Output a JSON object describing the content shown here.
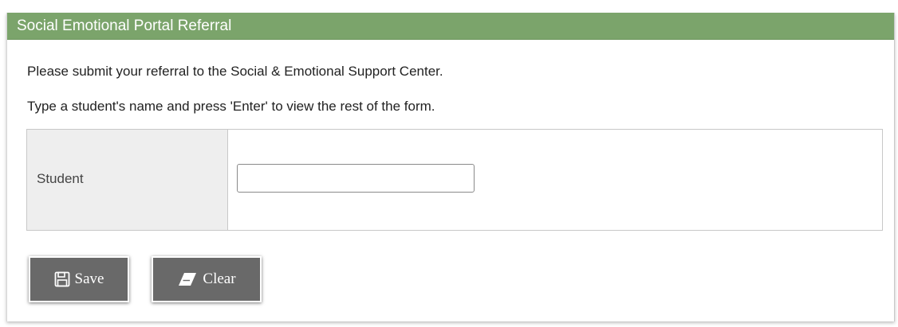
{
  "panel": {
    "title": "Social Emotional Portal Referral"
  },
  "intro": {
    "line1": "Please submit your referral to the Social & Emotional Support Center.",
    "line2": "Type a student's name and press 'Enter' to view the rest of the form."
  },
  "form": {
    "student_label": "Student",
    "student_value": "",
    "student_placeholder": ""
  },
  "buttons": {
    "save_label": "Save",
    "save_icon": "floppy-disk-icon",
    "clear_label": "Clear",
    "clear_icon": "eraser-icon"
  },
  "colors": {
    "header_bg": "#7ba46b",
    "button_bg": "#696969",
    "label_cell_bg": "#eeeeee"
  }
}
